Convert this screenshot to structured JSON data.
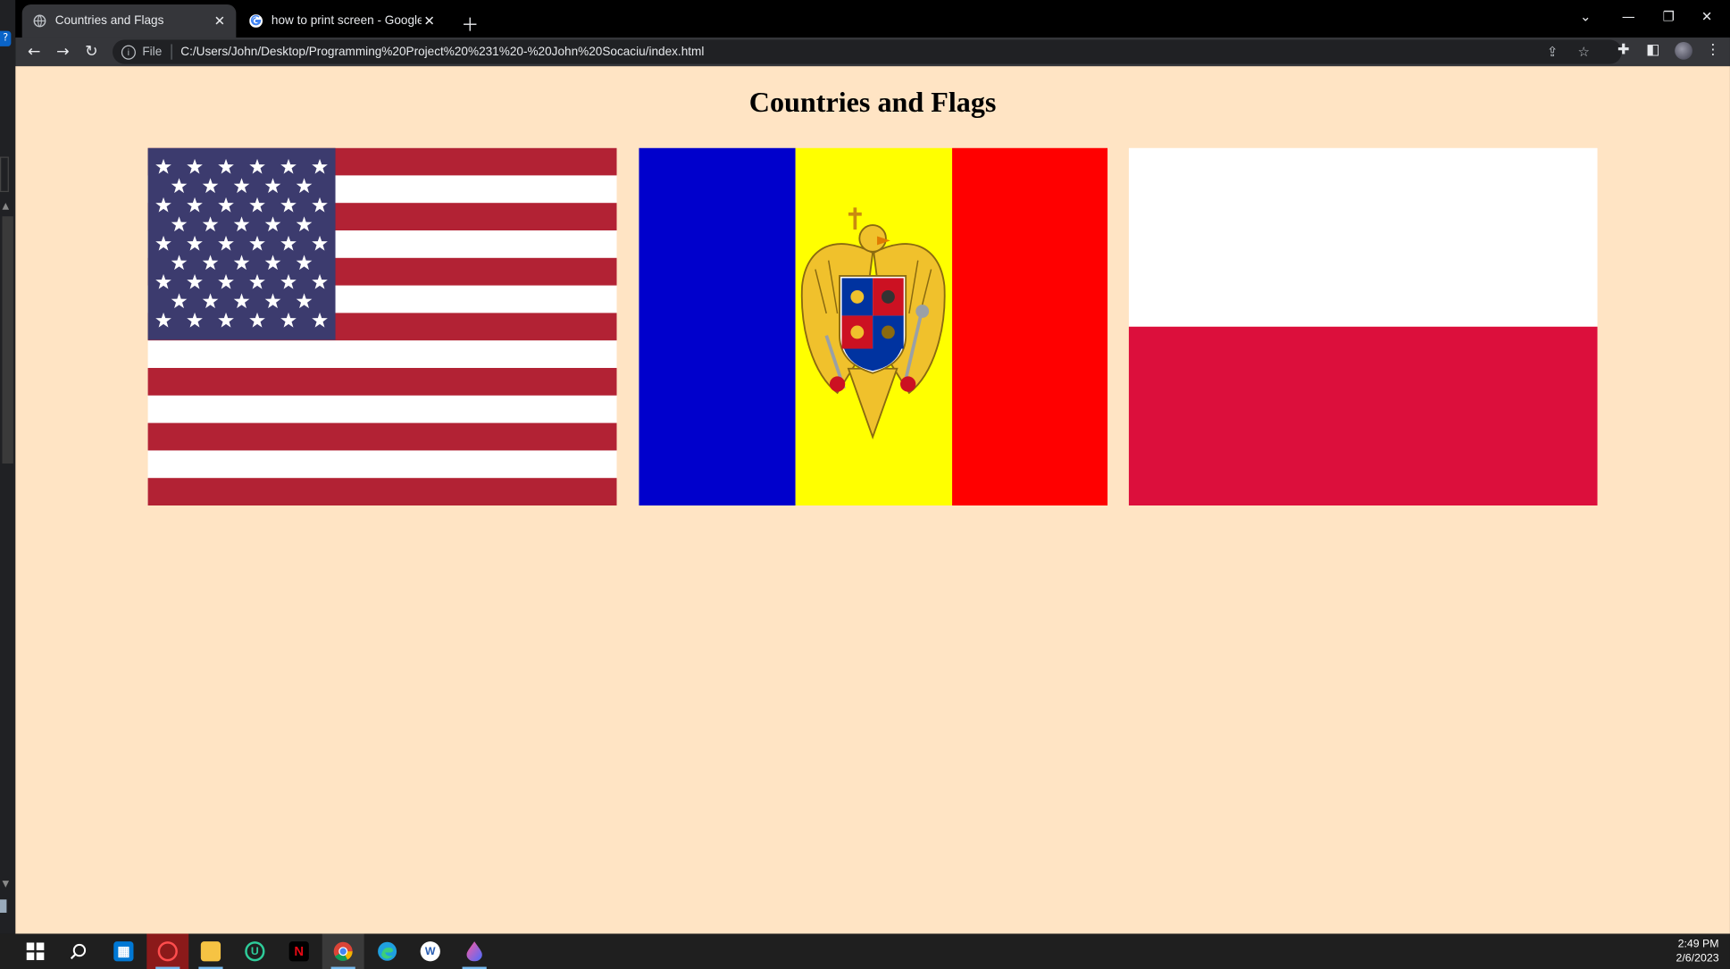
{
  "browser": {
    "tabs": [
      {
        "title": "Countries and Flags",
        "active": true,
        "favicon": "globe-icon"
      },
      {
        "title": "how to print screen - Google Sea",
        "active": false,
        "favicon": "google-icon"
      }
    ],
    "address": {
      "prefix": "File",
      "url": "C:/Users/John/Desktop/Programming%20Project%20%231%20-%20John%20Socaciu/index.html"
    }
  },
  "page": {
    "title": "Countries and Flags",
    "flags": [
      {
        "country": "United States",
        "colors": [
          "#b22234",
          "#ffffff",
          "#3c3b6e"
        ]
      },
      {
        "country": "Moldova",
        "colors": [
          "#0000cc",
          "#ffff00",
          "#ff0000"
        ]
      },
      {
        "country": "Poland",
        "colors": [
          "#ffffff",
          "#dc0f3c"
        ]
      }
    ],
    "background": "#ffe4c4"
  },
  "taskbar": {
    "apps": [
      "windows-start-icon",
      "search-icon",
      "store-icon",
      "opera-icon",
      "file-explorer-icon",
      "u-app-icon",
      "netflix-icon",
      "chrome-icon",
      "edge-icon",
      "w-app-icon",
      "drop-app-icon"
    ],
    "time": "2:49 PM",
    "date": "2/6/2023"
  }
}
